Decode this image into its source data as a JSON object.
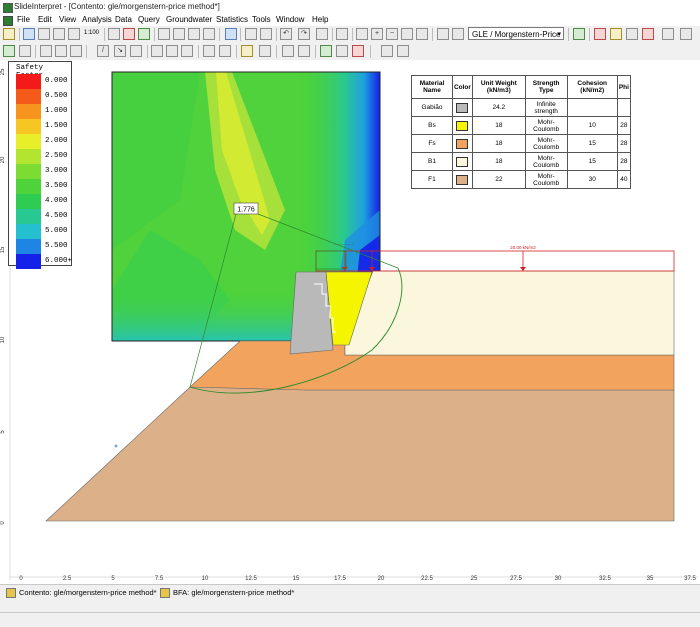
{
  "window": {
    "title": "SlideInterpret - [Contento: gle/morgenstern-price method*]"
  },
  "menu": [
    "File",
    "Edit",
    "View",
    "Analysis",
    "Data",
    "Query",
    "Groundwater",
    "Statistics",
    "Tools",
    "Window",
    "Help"
  ],
  "toolbar": {
    "scale_label": "1:100",
    "method_value": "GLE / Morgenstern-Price",
    "method_arrow": "▾"
  },
  "legend": {
    "title": "Safety Factor",
    "entries": [
      {
        "value": "0.000",
        "color": "#f41a1a"
      },
      {
        "value": "0.500",
        "color": "#f55a1a"
      },
      {
        "value": "1.000",
        "color": "#f7941e"
      },
      {
        "value": "1.500",
        "color": "#f6c623"
      },
      {
        "value": "2.000",
        "color": "#e9ee2a"
      },
      {
        "value": "2.500",
        "color": "#b2e530"
      },
      {
        "value": "3.000",
        "color": "#7ddc33"
      },
      {
        "value": "3.500",
        "color": "#4fd33a"
      },
      {
        "value": "4.000",
        "color": "#2fcc52"
      },
      {
        "value": "4.500",
        "color": "#27c892"
      },
      {
        "value": "5.000",
        "color": "#24c0d0"
      },
      {
        "value": "5.500",
        "color": "#1f85e5"
      },
      {
        "value": "6.000+",
        "color": "#1520e8"
      }
    ]
  },
  "materials": {
    "headers": [
      "Material Name",
      "Color",
      "Unit Weight (kN/m3)",
      "Strength Type",
      "Cohesion (kN/m2)",
      "Phi"
    ],
    "rows": [
      {
        "name": "Gabião",
        "color": "#b9b9b9",
        "unit_weight": "24.2",
        "strength": "Infinite strength",
        "cohesion": "",
        "phi": ""
      },
      {
        "name": "Bs",
        "color": "#f5f500",
        "unit_weight": "18",
        "strength": "Mohr-Coulomb",
        "cohesion": "10",
        "phi": "28"
      },
      {
        "name": "Fs",
        "color": "#f2a35e",
        "unit_weight": "18",
        "strength": "Mohr-Coulomb",
        "cohesion": "15",
        "phi": "28"
      },
      {
        "name": "B1",
        "color": "#fbf7dc",
        "unit_weight": "18",
        "strength": "Mohr-Coulomb",
        "cohesion": "15",
        "phi": "28"
      },
      {
        "name": "F1",
        "color": "#dcb088",
        "unit_weight": "22",
        "strength": "Mohr-Coulomb",
        "cohesion": "30",
        "phi": "40"
      }
    ]
  },
  "model": {
    "min_safety_factor": "1.776",
    "load_label": "20.00 kN/m2",
    "y_axis": [
      "0",
      "5",
      "10",
      "15",
      "20",
      "25"
    ],
    "x_axis": [
      "0",
      "2.5",
      "5",
      "7.5",
      "10",
      "12.5",
      "15",
      "17.5",
      "20",
      "22.5",
      "25",
      "27.5",
      "30",
      "32.5",
      "35",
      "37.5"
    ]
  },
  "tabs": [
    {
      "label": "Contento: gle/morgenstern-price method*"
    },
    {
      "label": "BFA: gle/morgenstern-price method*"
    }
  ]
}
